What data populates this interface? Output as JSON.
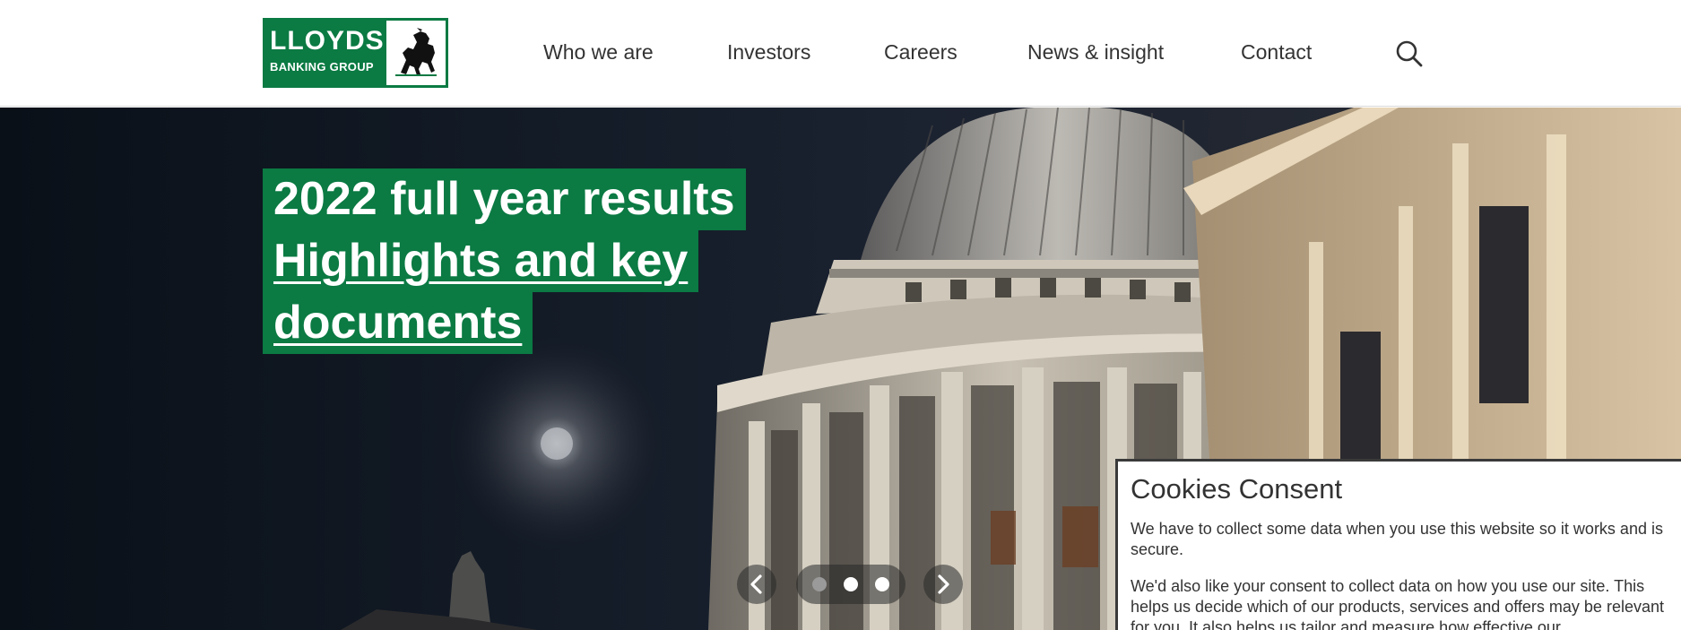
{
  "header": {
    "logo": {
      "word": "LLOYDS",
      "sub": "BANKING GROUP"
    },
    "nav": [
      {
        "label": "Who we are"
      },
      {
        "label": "Investors"
      },
      {
        "label": "Careers"
      },
      {
        "label": "News & insight"
      },
      {
        "label": "Contact"
      }
    ],
    "search_icon": "search-icon"
  },
  "hero": {
    "headline_line1": "2022 full year results",
    "link_line1": "Highlights and key",
    "link_line2": "documents",
    "carousel": {
      "slides": 3,
      "active_index": 1
    }
  },
  "cookie": {
    "title": "Cookies Consent",
    "para1": "We have to collect some data when you use this website so it works and is secure.",
    "para2": "We'd also like your consent to collect data on how you use our site. This helps us decide which of our products, services and offers may be relevant for you. It also helps us tailor and measure how effective our"
  },
  "colors": {
    "brand_green": "#0b7a43",
    "nav_text": "#333333"
  }
}
